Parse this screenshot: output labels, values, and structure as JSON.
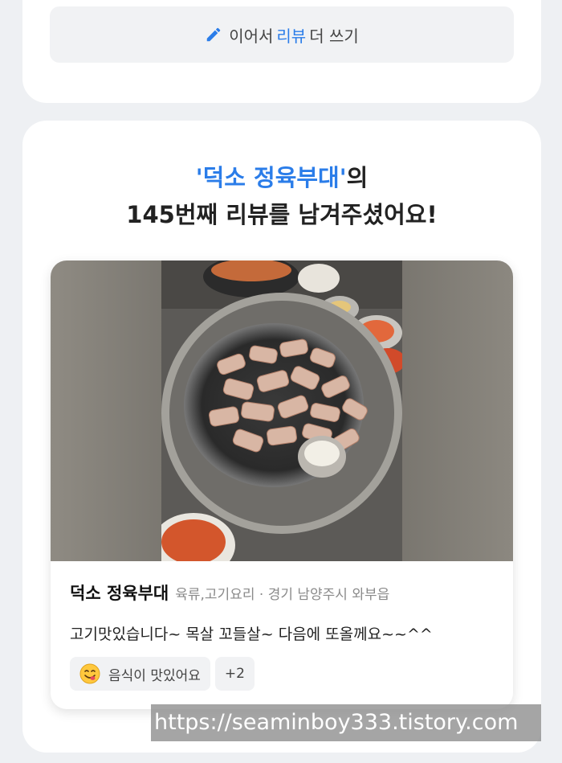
{
  "continue_button": {
    "prefix": "이어서 ",
    "highlight": "리뷰",
    "suffix": " 더 쓰기"
  },
  "headline": {
    "restaurant_quoted": "'덕소 정육부대'",
    "line1_suffix": "의",
    "line2": "145번째 리뷰를 남겨주셨어요!"
  },
  "review": {
    "restaurant_name": "덕소 정육부대",
    "meta": "육류,고기요리 · 경기 남양주시 와부읍",
    "text": "고기맛있습니다~ 목살 꼬들살~ 다음에 또올께요~~^^",
    "tags": [
      {
        "icon": "yum-emoji-icon",
        "label": "음식이 맛있어요"
      },
      {
        "label": "+2"
      }
    ]
  },
  "watermark": "https://seaminboy333.tistory.com",
  "colors": {
    "accent": "#2b7de9",
    "background": "#eef0f3",
    "card": "#ffffff",
    "button_bg": "#f1f2f4"
  }
}
